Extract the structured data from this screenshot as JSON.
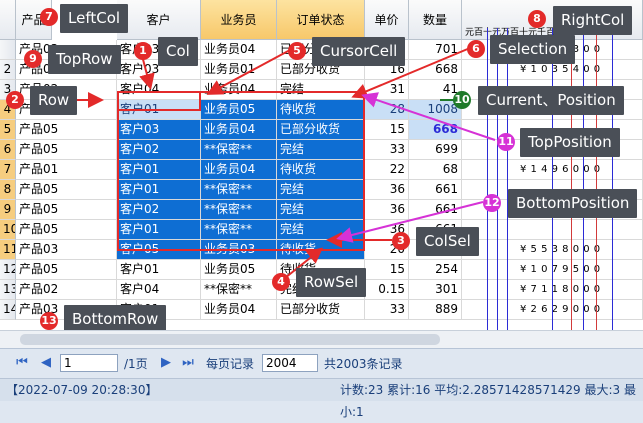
{
  "grid": {
    "row_numbers": [
      "2",
      "3",
      "4",
      "5",
      "6",
      "7",
      "8",
      "9",
      "10",
      "11",
      "12",
      "13",
      "14"
    ],
    "headers": {
      "product": "产品",
      "customer": "客户",
      "salesman": "业务员",
      "order_status": "订单状态",
      "unit_price": "单价",
      "quantity": "数量",
      "right_header": "元百十元万百十元千百万分",
      "right_header_prefix": "元"
    },
    "rows": [
      {
        "p": "产品03",
        "c": "客户03",
        "s": "业务员04",
        "o": "已部分收货",
        "u": "33",
        "q": "701",
        "r": "¥ 2 5 1 1 3 0 0"
      },
      {
        "p": "产品03",
        "c": "客户03",
        "s": "业务员01",
        "o": "已部分收货",
        "u": "16",
        "q": "668",
        "r": "¥ 1 0 3 5 4 0 0"
      },
      {
        "p": "产品02",
        "c": "客户04",
        "s": "业务员04",
        "o": "完结",
        "u": "31",
        "q": "41",
        "r": ""
      },
      {
        "p": "产品01",
        "c": "客户01",
        "s": "业务员05",
        "o": "待收货",
        "u": "28",
        "q": "1008",
        "r": ""
      },
      {
        "p": "产品05",
        "c": "客户03",
        "s": "业务员04",
        "o": "已部分收货",
        "u": "15",
        "q": "668",
        "r": ""
      },
      {
        "p": "产品05",
        "c": "客户02",
        "s": "**保密**",
        "o": "完结",
        "u": "33",
        "q": "699",
        "r": "¥ 2 1 7 7 5 0 0"
      },
      {
        "p": "产品01",
        "c": "客户01",
        "s": "业务员04",
        "o": "待收货",
        "u": "22",
        "q": "68",
        "r": "¥ 1 4 9 6 0 0 0"
      },
      {
        "p": "产品05",
        "c": "客户01",
        "s": "**保密**",
        "o": "完结",
        "u": "36",
        "q": "661",
        "r": ""
      },
      {
        "p": "产品05",
        "c": "客户02",
        "s": "**保密**",
        "o": "完结",
        "u": "36",
        "q": "661",
        "r": ""
      },
      {
        "p": "产品05",
        "c": "客户01",
        "s": "**保密**",
        "o": "完结",
        "u": "36",
        "q": "661",
        "r": ""
      },
      {
        "p": "产品03",
        "c": "客户05",
        "s": "业务员03",
        "o": "待收货",
        "u": "20",
        "q": "284",
        "r": "¥ 5 5 3 8 0 0 0"
      },
      {
        "p": "产品05",
        "c": "客户01",
        "s": "业务员05",
        "o": "待收货",
        "u": "15",
        "q": "254",
        "r": "¥ 1 0 7 9 5 0 0"
      },
      {
        "p": "产品02",
        "c": "客户04",
        "s": "**保密**",
        "o": "完结",
        "u": "0.15",
        "q": "301",
        "r": "¥ 7 1 1 8 0 0 0"
      },
      {
        "p": "产品03",
        "c": "客户01",
        "s": "业务员04",
        "o": "已部分收货",
        "u": "33",
        "q": "889",
        "r": "¥ 2 6 2 9 0 0 0"
      }
    ]
  },
  "callouts": {
    "leftcol": {
      "num": "7",
      "label": "LeftCol"
    },
    "rightcol": {
      "num": "8",
      "label": "RightCol"
    },
    "toprow": {
      "num": "9",
      "label": "TopRow"
    },
    "col": {
      "num": "1",
      "label": "Col"
    },
    "cursorcell": {
      "num": "5",
      "label": "CursorCell"
    },
    "selection": {
      "num": "6",
      "label": "Selection"
    },
    "row": {
      "num": "2",
      "label": "Row"
    },
    "current": {
      "num": "10",
      "label": "Current、Position"
    },
    "topposition": {
      "num": "11",
      "label": "TopPosition"
    },
    "bottomposition": {
      "num": "12",
      "label": "BottomPosition"
    },
    "colsel": {
      "num": "3",
      "label": "ColSel"
    },
    "rowsel": {
      "num": "4",
      "label": "RowSel"
    },
    "bottomrow": {
      "num": "13",
      "label": "BottomRow"
    }
  },
  "pager": {
    "page_value": "1",
    "page_total": "/1页",
    "per_page_label": "每页记录",
    "per_page_value": "2004",
    "total_label": "共2003条记录"
  },
  "status": {
    "datetime": "【2022-07-09 20:28:30】",
    "stats": "计数:23 累计:16 平均:2.28571428571429 最大:3 最小:1"
  },
  "colors": {
    "selection_blue": "#0e6ed3",
    "callout_bg": "#4a4f57",
    "badge_red": "#e32a2a",
    "badge_pink": "#d632d6",
    "badge_green": "#1f7a2a",
    "cursor_border": "#e32a2a"
  }
}
